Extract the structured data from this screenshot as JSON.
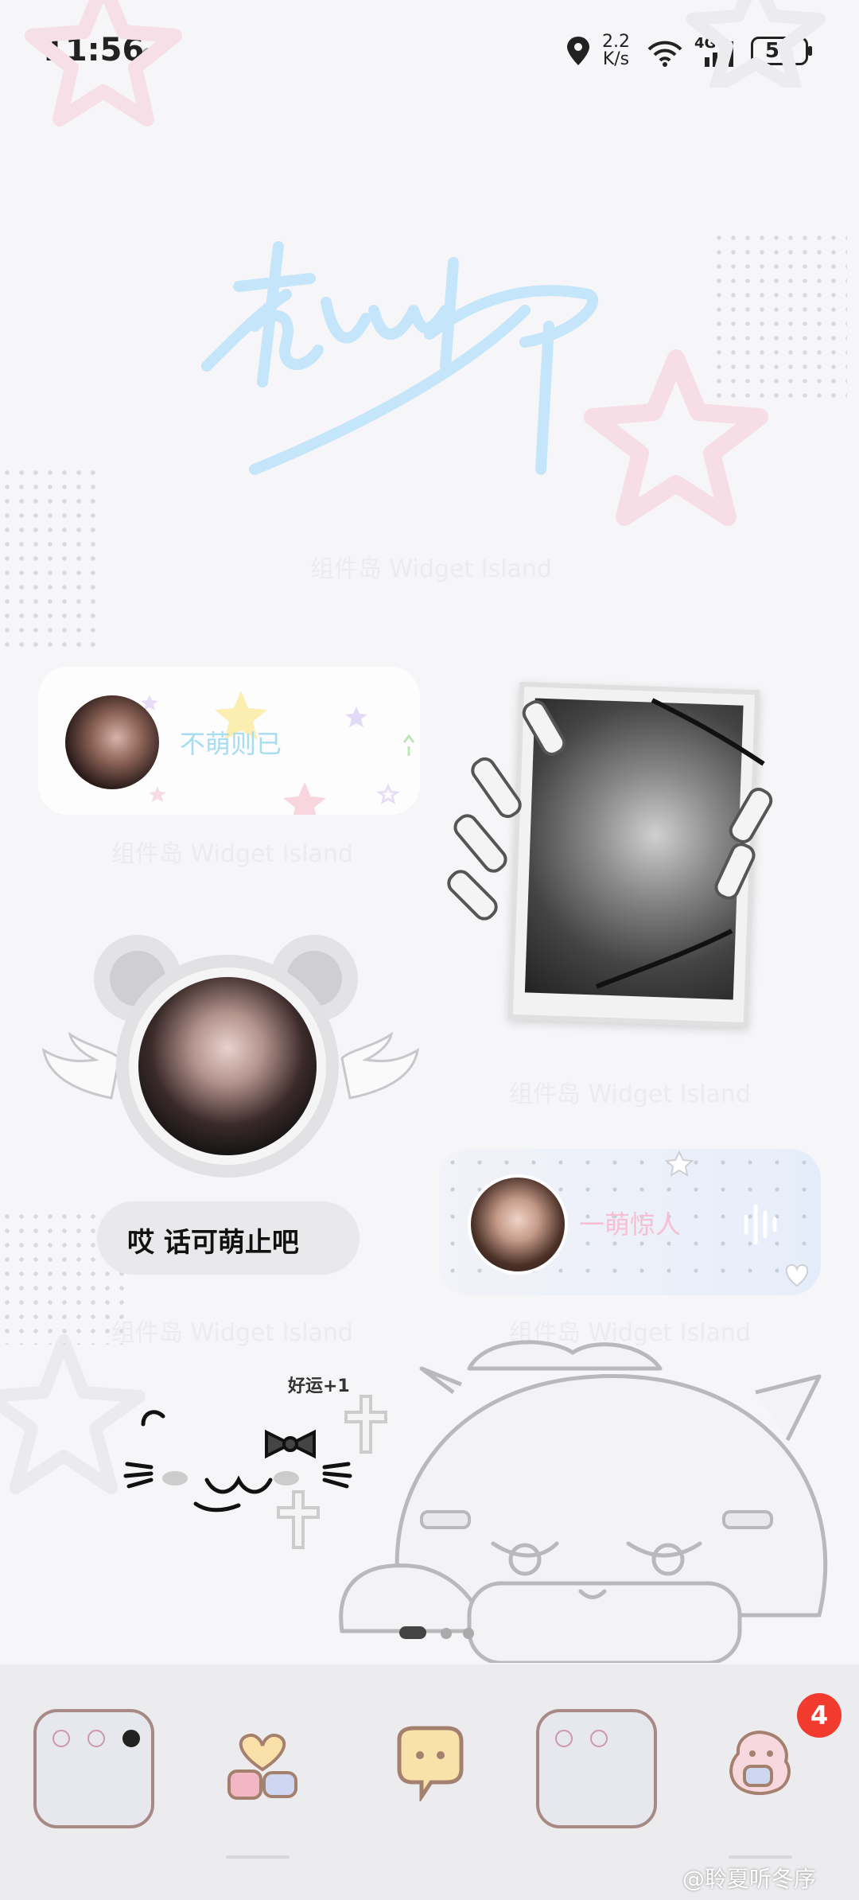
{
  "status_bar": {
    "time": "11:56",
    "net_speed_value": "2.2",
    "net_speed_unit": "K/s",
    "network_type": "4G",
    "battery": "58"
  },
  "signature_watermark": "组件岛 Widget Island",
  "widgets": {
    "banner_text": "不萌则已",
    "banner_watermark": "组件岛 Widget Island",
    "photo_watermark": "组件岛 Widget Island",
    "bubble_text": "哎 话可萌止吧",
    "bear_watermark": "组件岛 Widget Island",
    "pill_text": "一萌惊人",
    "pill_watermark": "组件岛 Widget Island",
    "luck_text": "好运+1"
  },
  "page_indicator": {
    "pages": 3,
    "current": 1
  },
  "dock": {
    "badge_count": "4",
    "apps": [
      {
        "name": "folder-1"
      },
      {
        "name": "hearts-app"
      },
      {
        "name": "chat-app"
      },
      {
        "name": "folder-2"
      },
      {
        "name": "game-app"
      }
    ]
  },
  "credit": "@聆夏听冬序",
  "colors": {
    "signature": "#c5e6fa",
    "dock_bg": "#ececef",
    "badge": "#f23b2f",
    "pink_star": "#f7dde6"
  }
}
